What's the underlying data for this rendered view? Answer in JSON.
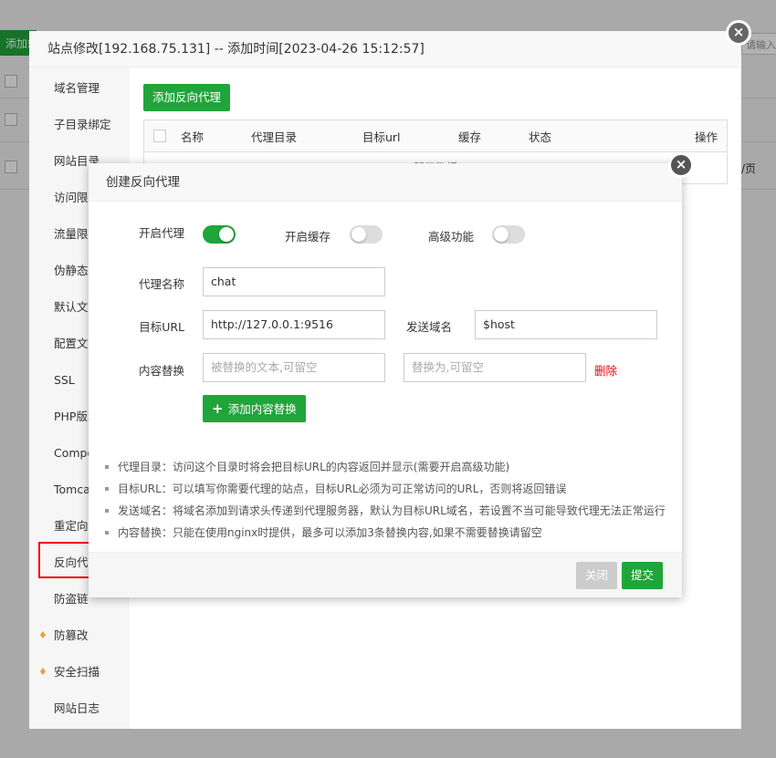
{
  "background": {
    "add_label": "添加站点",
    "search_placeholder": "请输入域名",
    "per_page": "/页"
  },
  "outer": {
    "title": "站点修改[192.168.75.131] -- 添加时间[2023-04-26 15:12:57]",
    "sidebar": [
      {
        "label": "域名管理"
      },
      {
        "label": "子目录绑定"
      },
      {
        "label": "网站目录"
      },
      {
        "label": "访问限制"
      },
      {
        "label": "流量限制"
      },
      {
        "label": "伪静态"
      },
      {
        "label": "默认文档"
      },
      {
        "label": "配置文件"
      },
      {
        "label": "SSL"
      },
      {
        "label": "PHP版本"
      },
      {
        "label": "Composer"
      },
      {
        "label": "Tomcat"
      },
      {
        "label": "重定向"
      },
      {
        "label": "反向代理",
        "active": true
      },
      {
        "label": "防盗链"
      },
      {
        "label": "防篡改",
        "icon": "gem-icon"
      },
      {
        "label": "安全扫描",
        "icon": "gem-icon"
      },
      {
        "label": "网站日志"
      }
    ],
    "add_proxy_button": "添加反向代理",
    "table": {
      "columns": [
        "名称",
        "代理目录",
        "目标url",
        "缓存",
        "状态",
        "操作"
      ],
      "empty": "暂无数据"
    }
  },
  "dialog": {
    "title": "创建反向代理",
    "enable_proxy": {
      "label": "开启代理",
      "on": true
    },
    "enable_cache": {
      "label": "开启缓存",
      "on": false
    },
    "advanced": {
      "label": "高级功能",
      "on": false
    },
    "proxy_name": {
      "label": "代理名称",
      "value": "chat"
    },
    "target_url": {
      "label": "目标URL",
      "value": "http://127.0.0.1:9516"
    },
    "send_domain": {
      "label": "发送域名",
      "value": "$host"
    },
    "replace": {
      "label": "内容替换",
      "from_placeholder": "被替换的文本,可留空",
      "to_placeholder": "替换为,可留空",
      "delete": "删除"
    },
    "add_replace_button": "添加内容替换",
    "tips": [
      "代理目录：访问这个目录时将会把目标URL的内容返回并显示(需要开启高级功能)",
      "目标URL：可以填写你需要代理的站点，目标URL必须为可正常访问的URL，否则将返回错误",
      "发送域名：将域名添加到请求头传递到代理服务器，默认为目标URL域名，若设置不当可能导致代理无法正常运行",
      "内容替换：只能在使用nginx时提供，最多可以添加3条替换内容,如果不需要替换请留空"
    ],
    "close_button": "关闭",
    "submit_button": "提交"
  },
  "colors": {
    "accent": "#20a53a",
    "danger": "#ee0000"
  }
}
